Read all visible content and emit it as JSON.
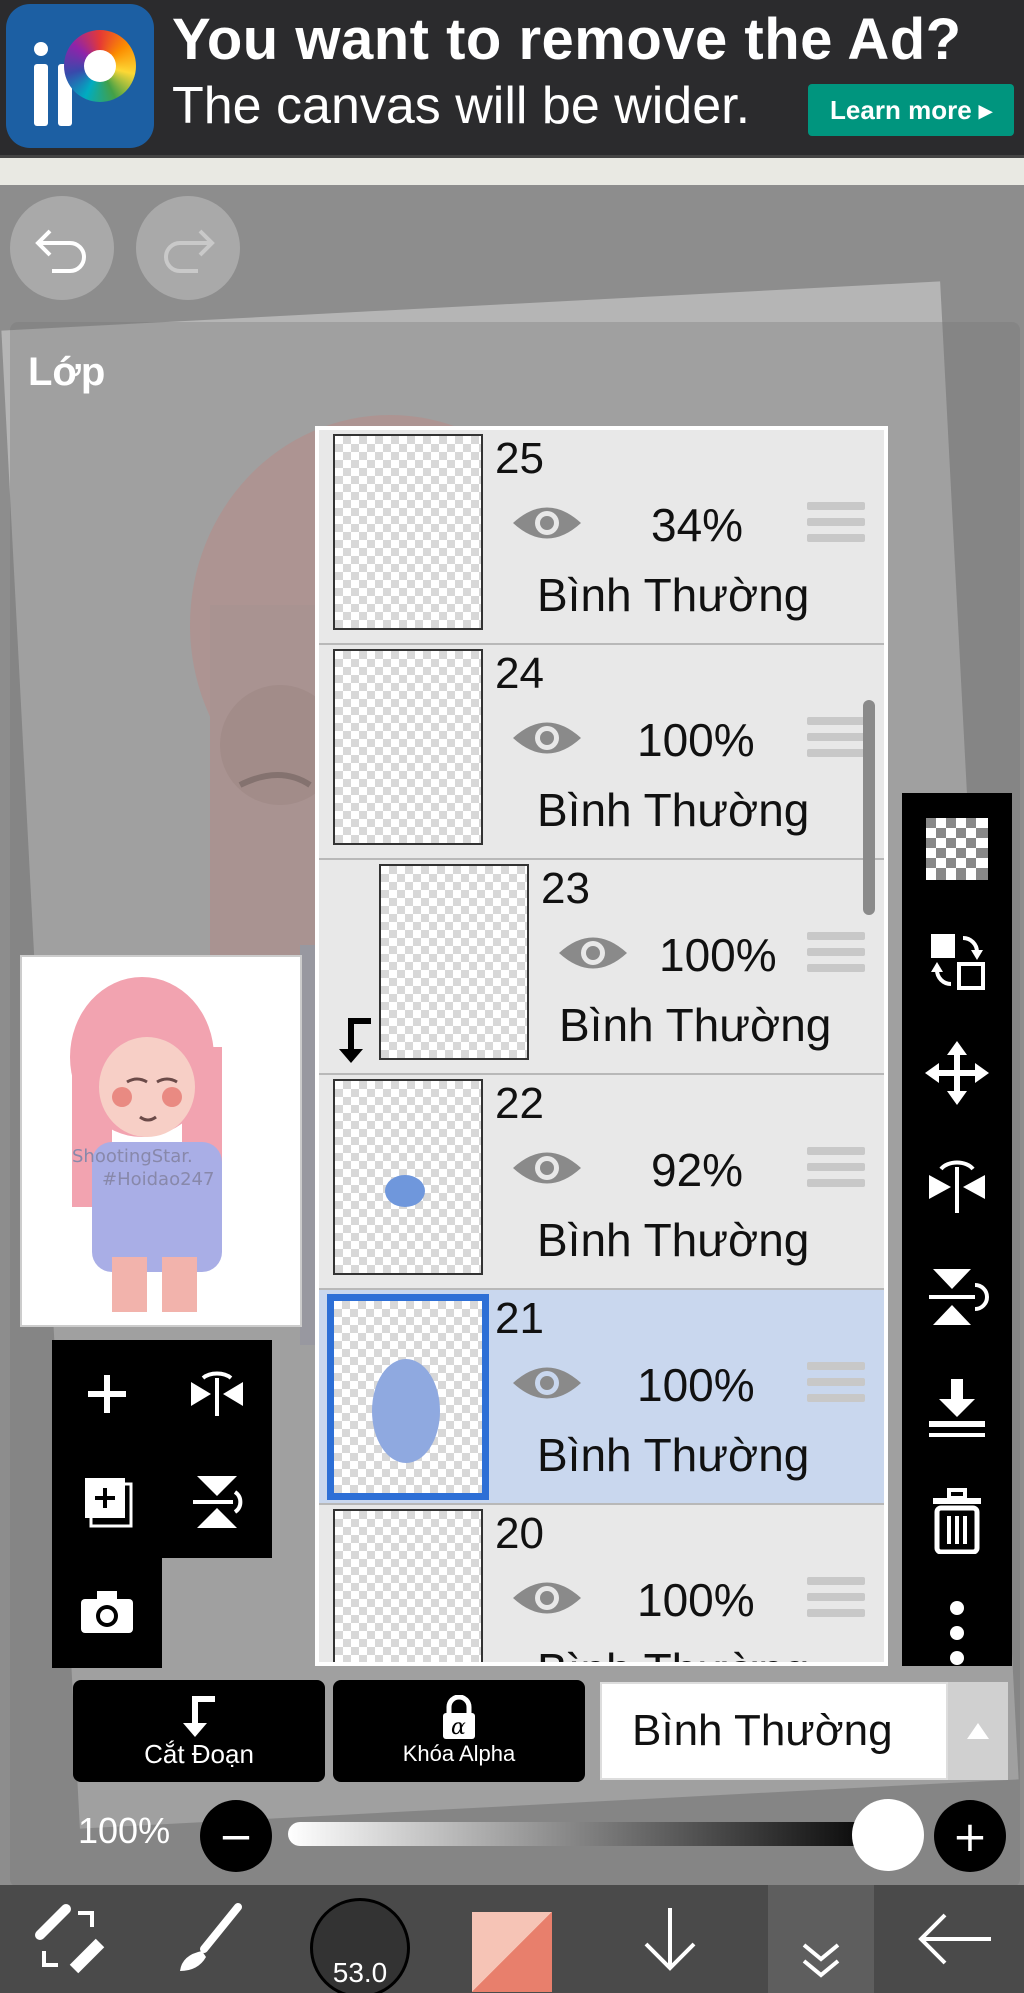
{
  "ad": {
    "title": "You want to remove the Ad?",
    "subtitle": "The canvas will be wider.",
    "learn_more": "Learn more ▸"
  },
  "layer_panel": {
    "title": "Lớp"
  },
  "layers": [
    {
      "number": "25",
      "opacity": "34%",
      "mode": "Bình Thường"
    },
    {
      "number": "24",
      "opacity": "100%",
      "mode": "Bình Thường"
    },
    {
      "number": "23",
      "opacity": "100%",
      "mode": "Bình Thường"
    },
    {
      "number": "22",
      "opacity": "92%",
      "mode": "Bình Thường"
    },
    {
      "number": "21",
      "opacity": "100%",
      "mode": "Bình Thường"
    },
    {
      "number": "20",
      "opacity": "100%",
      "mode": "Bình Thường"
    }
  ],
  "preview": {
    "watermark_line1": "ShootingStar.",
    "watermark_line2": "#Hoidao247"
  },
  "bottom": {
    "clip_label": "Cắt Đoạn",
    "alpha_label": "Khóa Alpha",
    "blend_mode": "Bình Thường",
    "opacity_label": "100%",
    "opacity_value": 1.0
  },
  "toolbar": {
    "brush_size": "53.0"
  },
  "colors": {
    "selected_layer_bg": "#c9d7ee",
    "selected_thumb_border": "#2d6fd6",
    "ad_button": "#00957e",
    "primary_color": "#e87f6c",
    "secondary_color": "#f6c4b6"
  },
  "selected_layer": "21",
  "icons": {
    "undo": "undo-icon",
    "redo": "redo-icon",
    "add_layer": "plus-icon",
    "flip_h": "flip-horizontal-icon",
    "duplicate": "duplicate-layer-icon",
    "flip_v": "flip-vertical-icon",
    "camera": "camera-icon",
    "checker": "transparent-checker-icon",
    "swap": "swap-layer-icon",
    "move": "move-icon",
    "merge_down": "merge-down-icon",
    "trash": "trash-icon",
    "more": "more-vertical-icon"
  }
}
